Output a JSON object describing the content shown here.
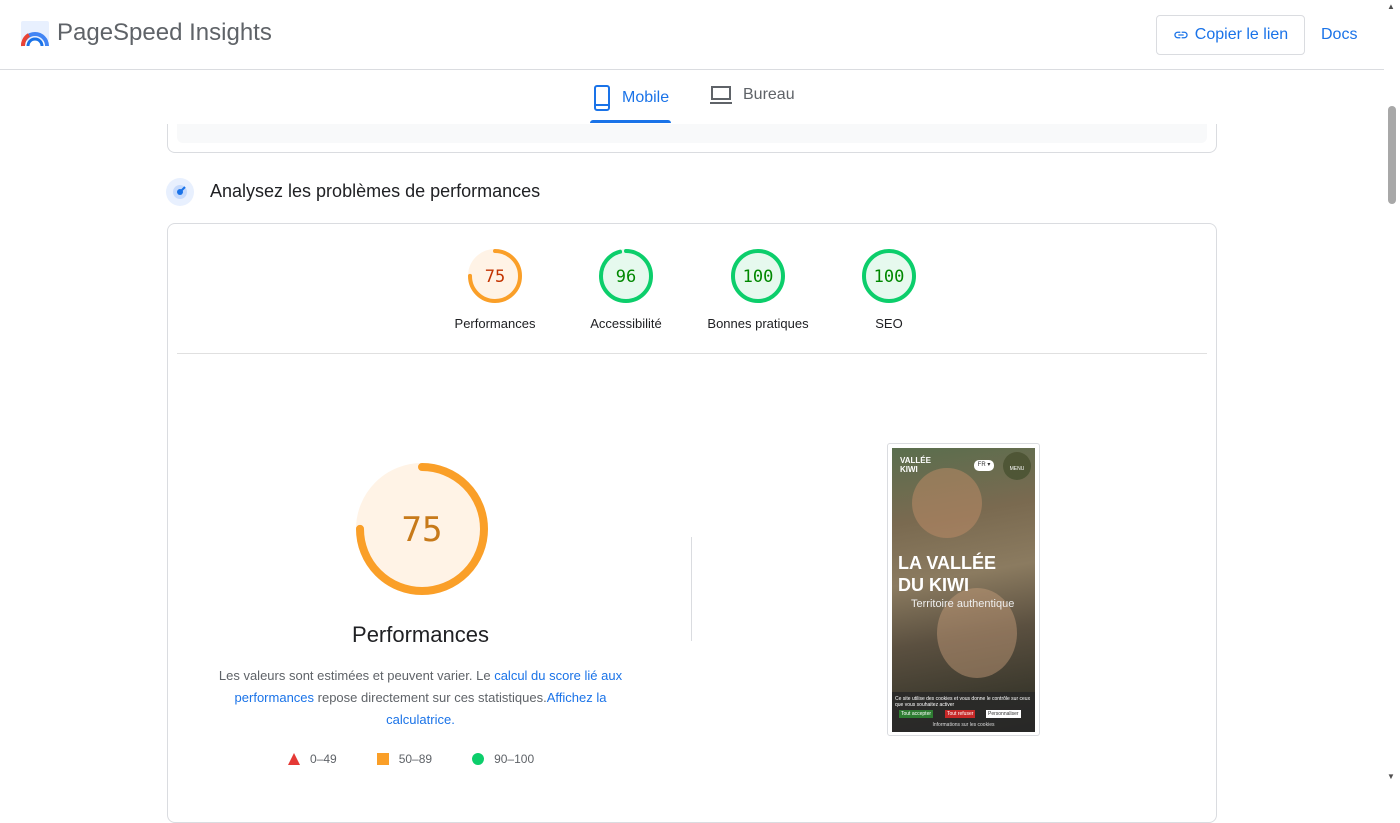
{
  "header": {
    "app_title": "PageSpeed Insights",
    "copy_link_label": "Copier le lien",
    "docs_label": "Docs"
  },
  "tabs": [
    {
      "label": "Mobile",
      "icon": "smartphone-icon",
      "active": true
    },
    {
      "label": "Bureau",
      "icon": "laptop-icon",
      "active": false
    }
  ],
  "section": {
    "title": "Analysez les problèmes de performances"
  },
  "scores": [
    {
      "value": "75",
      "label": "Performances",
      "status": "average",
      "fraction": 0.75
    },
    {
      "value": "96",
      "label": "Accessibilité",
      "status": "pass",
      "fraction": 0.96
    },
    {
      "value": "100",
      "label": "Bonnes pratiques",
      "status": "pass",
      "fraction": 1.0
    },
    {
      "value": "100",
      "label": "SEO",
      "status": "pass",
      "fraction": 1.0
    }
  ],
  "main_score": {
    "value": "75",
    "fraction": 0.75,
    "title": "Performances",
    "desc_prefix": "Les valeurs sont estimées et peuvent varier. Le ",
    "desc_link1": "calcul du score lié aux performances",
    "desc_middle": " repose directement sur ces statistiques.",
    "desc_link2": "Affichez la calculatrice."
  },
  "legend": [
    {
      "shape": "triangle",
      "range": "0–49",
      "color": "#e53935"
    },
    {
      "shape": "square",
      "range": "50–89",
      "color": "#fa9f28"
    },
    {
      "shape": "circle",
      "range": "90–100",
      "color": "#0cce6b"
    }
  ],
  "thumbnail": {
    "brand_line1": "VALLÉE",
    "brand_line2": "KIWI",
    "lang": "FR ▾",
    "menu": "MENU",
    "headline": "LA VALLÉE\nDU KIWI",
    "subtitle": "Territoire authentique",
    "cookie_text": "Ce site utilise des cookies et vous donne le contrôle sur ceux que vous souhaitez activer",
    "accept": "Tout accepter",
    "refuse": "Tout refuser",
    "customize": "Personnaliser",
    "cookie_info": "Informations sur les cookies"
  },
  "colors": {
    "accent": "#1a73e8",
    "average": "#fa9f28",
    "average_text": "#c33300",
    "pass": "#0cce6b",
    "pass_text": "#008800"
  }
}
